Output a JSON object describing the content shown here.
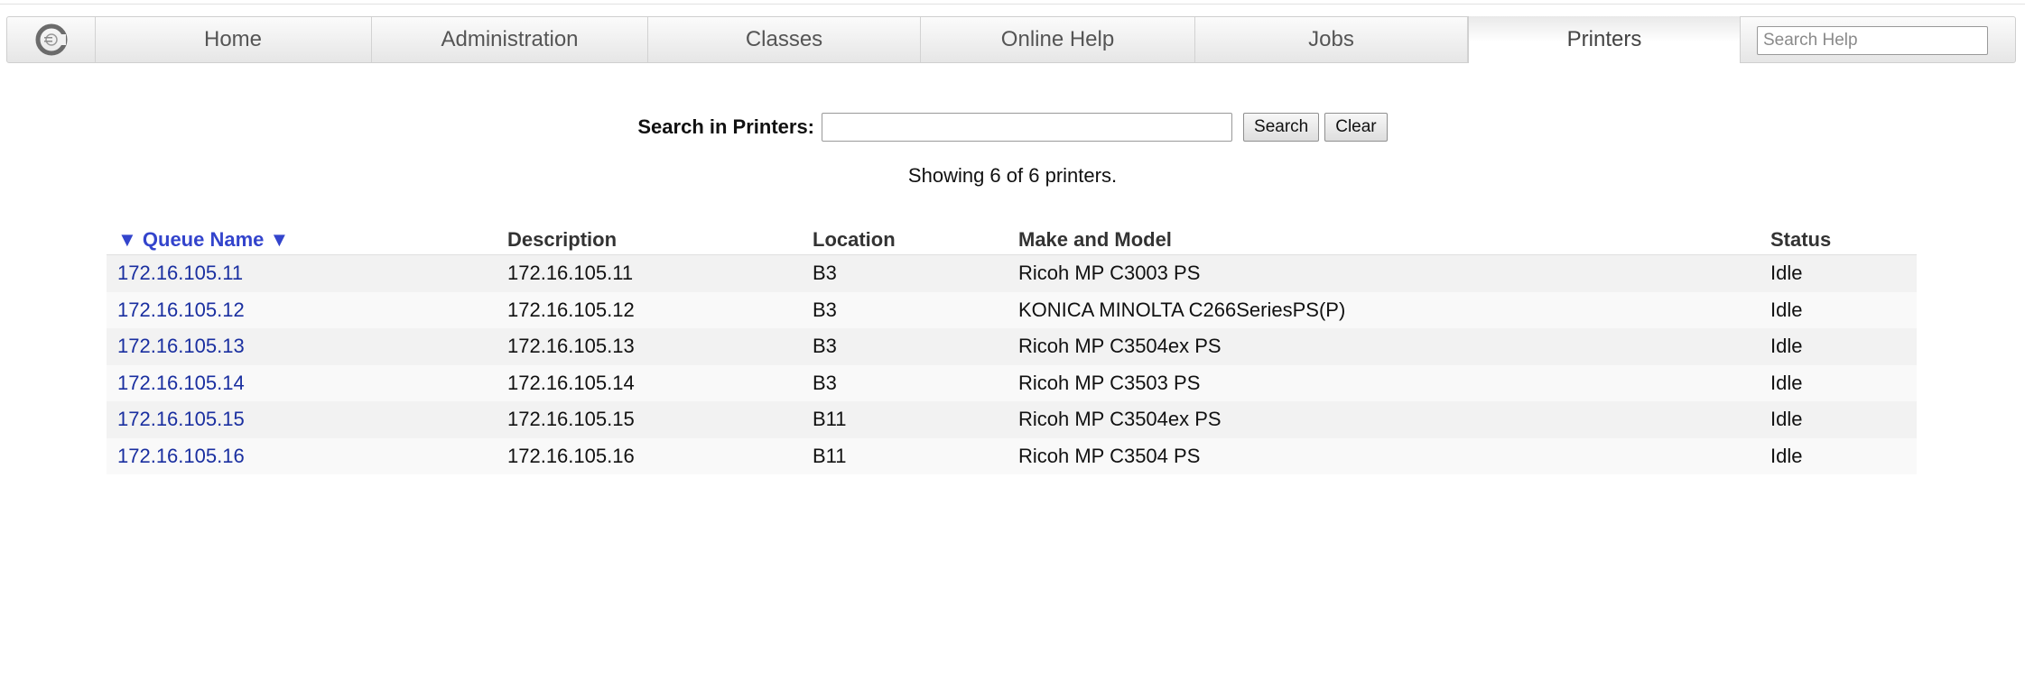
{
  "nav": {
    "logo": "CUPS logo",
    "tabs": [
      {
        "label": "Home",
        "active": false
      },
      {
        "label": "Administration",
        "active": false
      },
      {
        "label": "Classes",
        "active": false
      },
      {
        "label": "Online Help",
        "active": false
      },
      {
        "label": "Jobs",
        "active": false
      },
      {
        "label": "Printers",
        "active": true
      }
    ],
    "search_placeholder": "Search Help"
  },
  "search": {
    "label": "Search in Printers:",
    "value": "",
    "search_button": "Search",
    "clear_button": "Clear"
  },
  "summary": "Showing 6 of 6 printers.",
  "table": {
    "headers": [
      "▼ Queue Name ▼",
      "Description",
      "Location",
      "Make and Model",
      "Status"
    ],
    "rows": [
      {
        "queue": "172.16.105.11",
        "description": "172.16.105.11",
        "location": "B3",
        "model": "Ricoh MP C3003 PS",
        "status": "Idle"
      },
      {
        "queue": "172.16.105.12",
        "description": "172.16.105.12",
        "location": "B3",
        "model": "KONICA MINOLTA C266SeriesPS(P)",
        "status": "Idle"
      },
      {
        "queue": "172.16.105.13",
        "description": "172.16.105.13",
        "location": "B3",
        "model": "Ricoh MP C3504ex PS",
        "status": "Idle"
      },
      {
        "queue": "172.16.105.14",
        "description": "172.16.105.14",
        "location": "B3",
        "model": "Ricoh MP C3503 PS",
        "status": "Idle"
      },
      {
        "queue": "172.16.105.15",
        "description": "172.16.105.15",
        "location": "B11",
        "model": "Ricoh MP C3504ex PS",
        "status": "Idle"
      },
      {
        "queue": "172.16.105.16",
        "description": "172.16.105.16",
        "location": "B11",
        "model": "Ricoh MP C3504 PS",
        "status": "Idle"
      }
    ]
  },
  "colors": {
    "link": "#1a2fa0",
    "sort_header": "#3344cc"
  }
}
